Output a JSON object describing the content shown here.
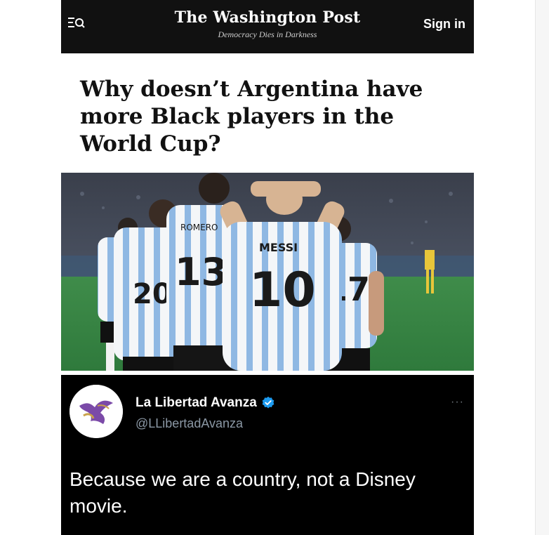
{
  "header": {
    "menu_icon": "menu-search-icon",
    "title": "The Washington Post",
    "tagline": "Democracy Dies in Darkness",
    "signin_label": "Sign in"
  },
  "article": {
    "headline": "Why doesn’t Argentina have more Black players in the World Cup?"
  },
  "photo": {
    "jersey_names": [
      "MESSI",
      "ROMERO"
    ],
    "jersey_numbers": [
      "10",
      "13",
      "17",
      "20",
      "7"
    ]
  },
  "tweet": {
    "display_name": "La Libertad Avanza",
    "handle": "@LLibertadAvanza",
    "text": "Because we are a country, not a Disney movie.",
    "more_label": "···",
    "verified_icon": "verified-badge-icon"
  },
  "colors": {
    "header_bg": "#111111",
    "tweet_bg": "#000000",
    "verified_blue": "#1d9bf0",
    "handle_gray": "#8b98a5"
  }
}
